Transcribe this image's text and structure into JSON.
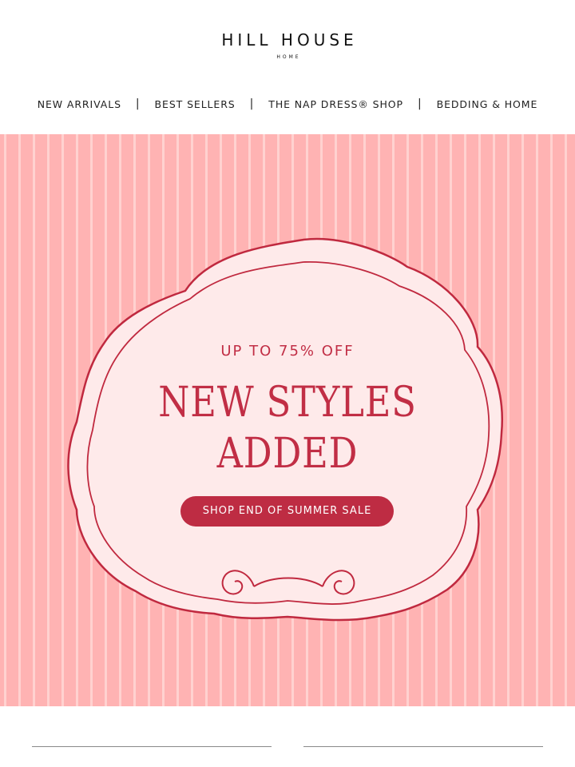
{
  "brand": {
    "name": "HILL HOUSE",
    "sub": "HOME"
  },
  "nav": {
    "items": [
      {
        "label": "NEW ARRIVALS"
      },
      {
        "label": "BEST SELLERS"
      },
      {
        "label": "THE NAP DRESS® SHOP"
      },
      {
        "label": "BEDDING & HOME"
      }
    ],
    "separator": "|"
  },
  "hero": {
    "promo": "UP TO 75% OFF",
    "headline_1": "NEW STYLES",
    "headline_2": "ADDED",
    "cta_label": "SHOP END OF SUMMER SALE",
    "colors": {
      "stripe_bg": "#ffb3b3",
      "stripe_light": "#ffd2d0",
      "frame_fill": "#feeaea",
      "frame_stroke": "#c0293f",
      "text": "#c12e45",
      "button": "#be2c43"
    }
  }
}
